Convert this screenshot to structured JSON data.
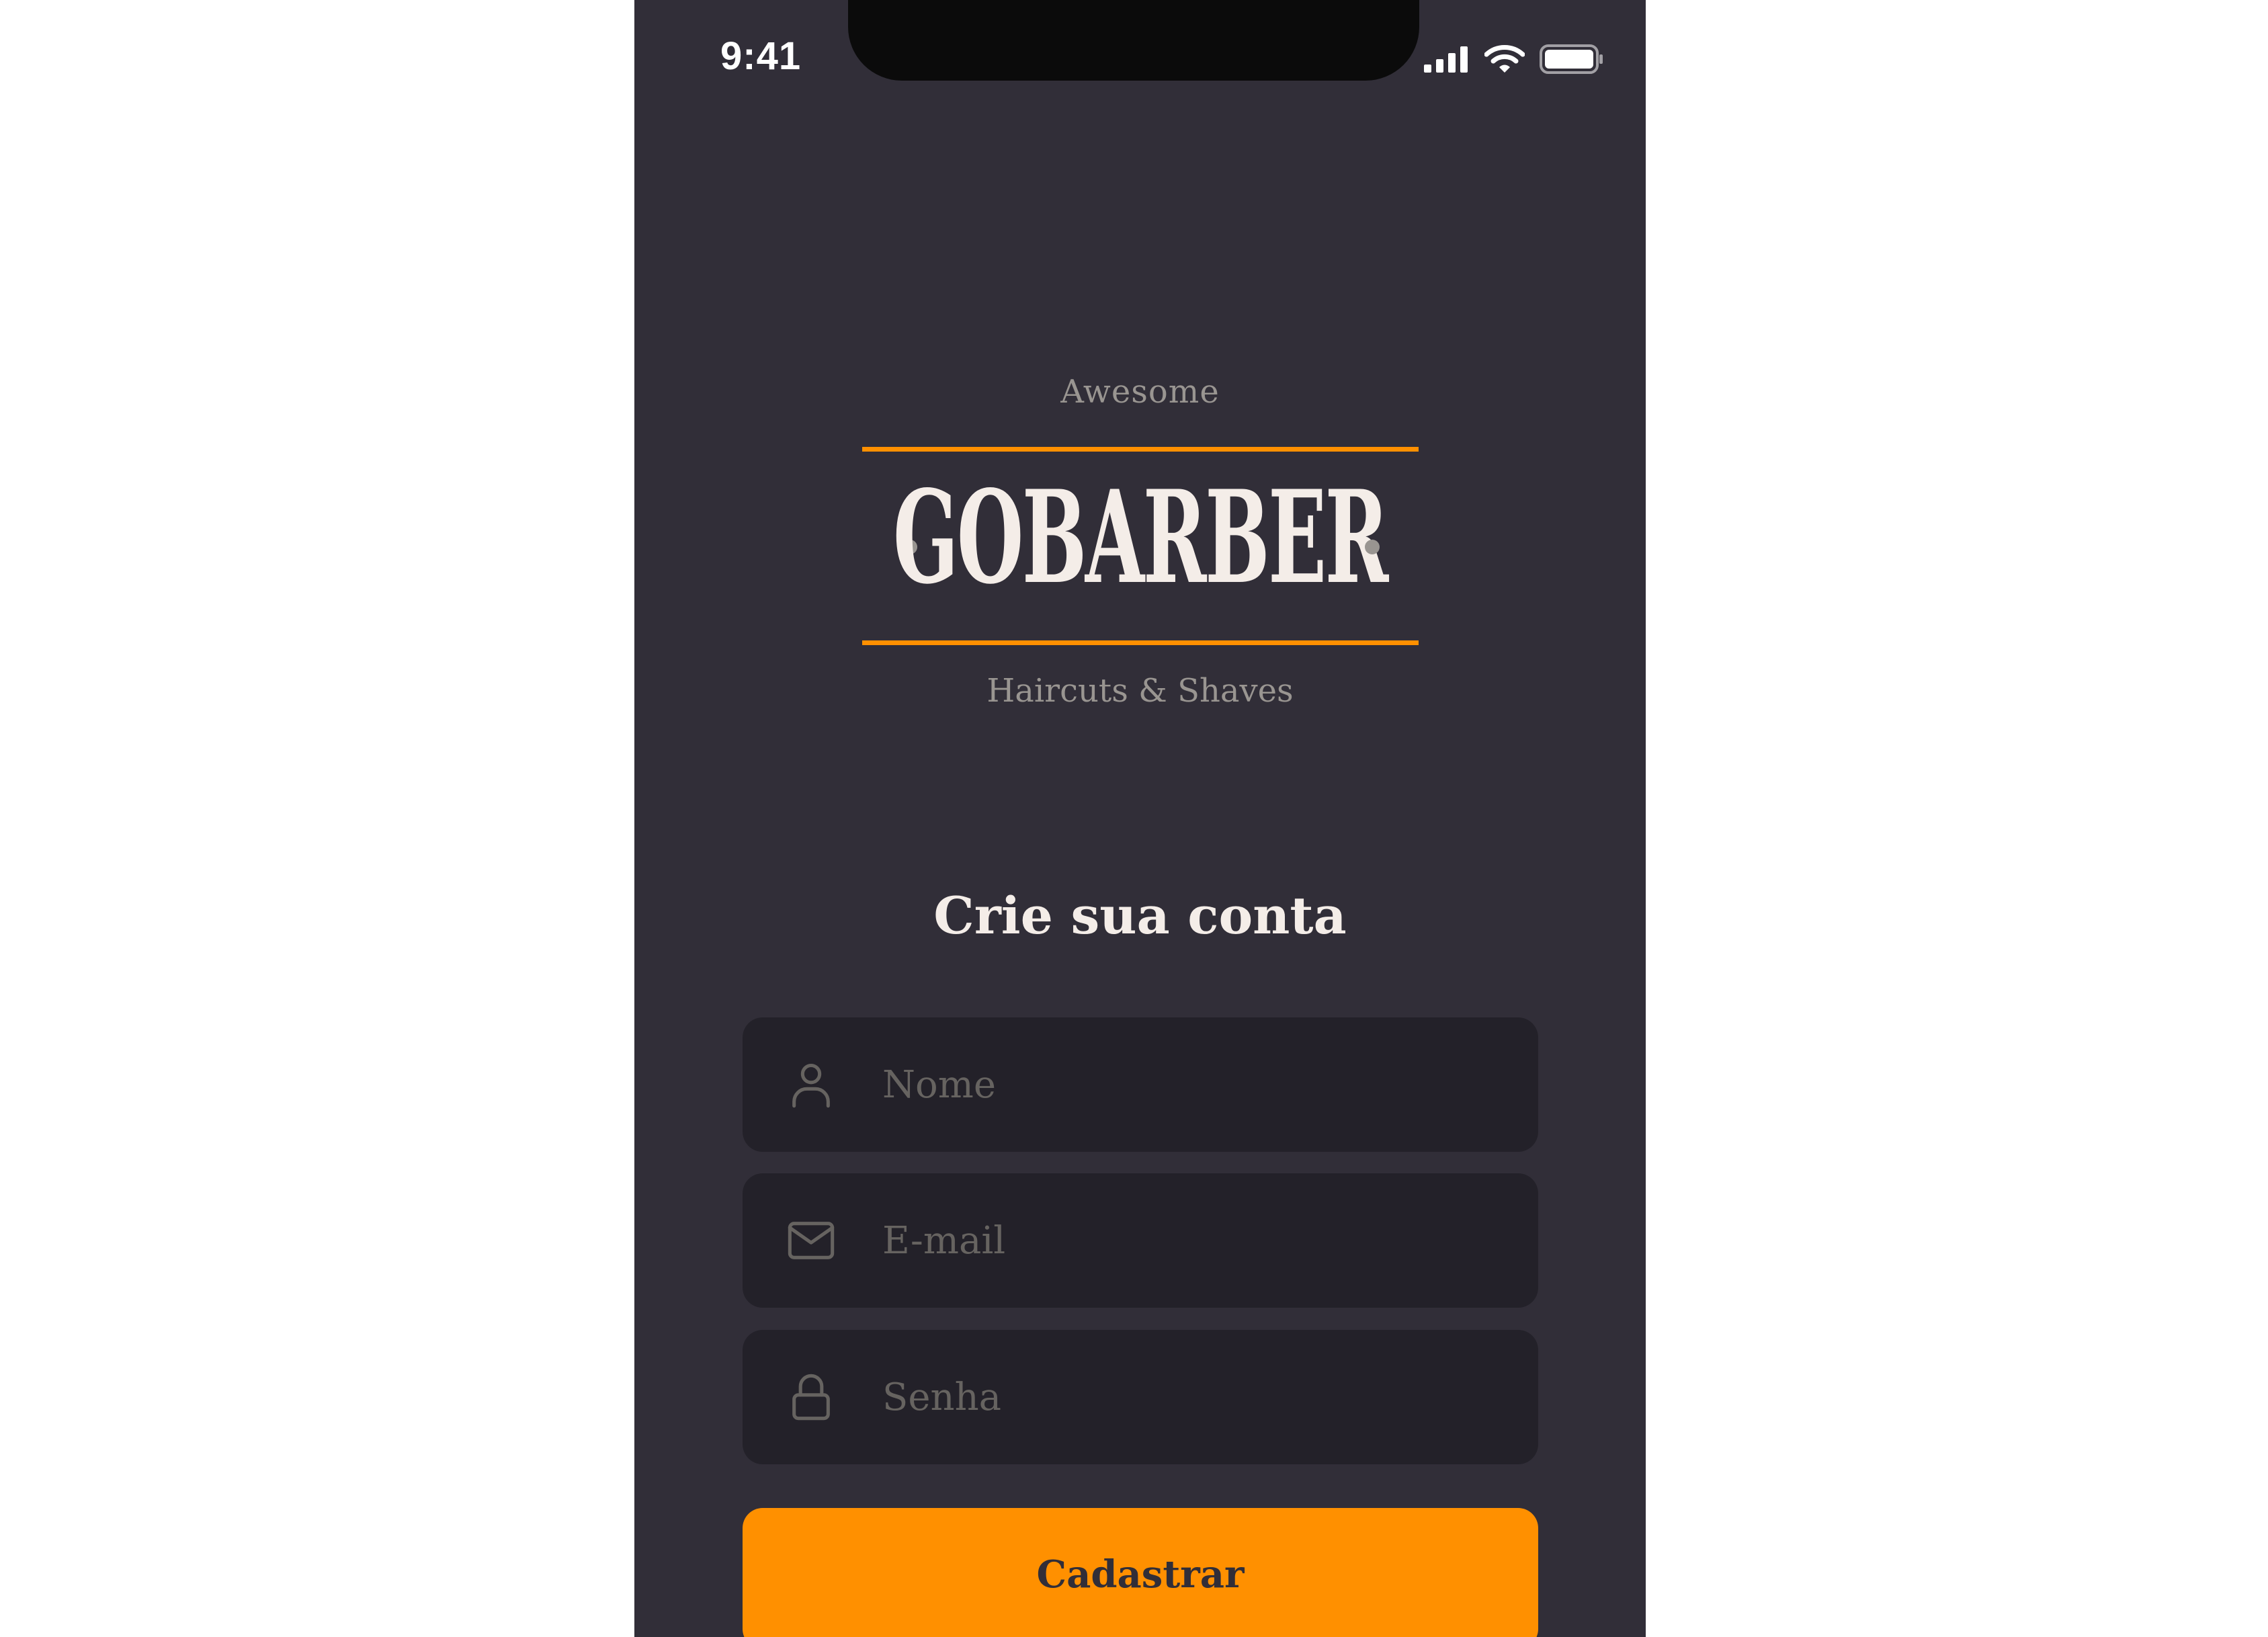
{
  "status_bar": {
    "time": "9:41",
    "icons": [
      "signal-icon",
      "wifi-icon",
      "battery-icon"
    ]
  },
  "logo": {
    "top_text": "Awesome",
    "wordmark": "GOBARBER",
    "bottom_text": "Haircuts & Shaves",
    "accent_color": "#FF9000"
  },
  "form": {
    "title": "Crie sua conta",
    "fields": [
      {
        "icon": "user-icon",
        "placeholder": "Nome",
        "value": ""
      },
      {
        "icon": "mail-icon",
        "placeholder": "E-mail",
        "value": ""
      },
      {
        "icon": "lock-icon",
        "placeholder": "Senha",
        "value": ""
      }
    ],
    "submit_label": "Cadastrar"
  },
  "colors": {
    "background": "#312E38",
    "input_background": "#232129",
    "primary": "#FF9000",
    "text": "#F4EDE8",
    "muted": "#999591",
    "placeholder": "#666360"
  }
}
